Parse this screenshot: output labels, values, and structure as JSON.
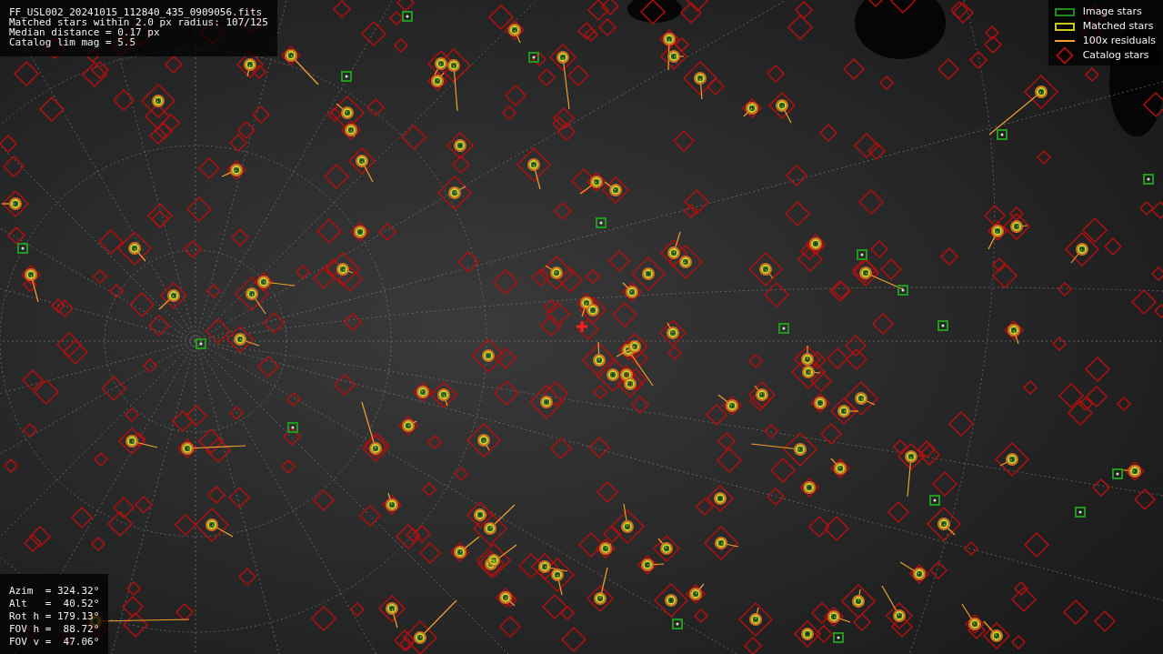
{
  "header": {
    "lines": [
      "FF_USL002_20241015_112840_435_0909056.fits",
      "Matched stars within 2.0 px radius: 107/125",
      "Median distance = 0.17 px",
      "Catalog lim mag = 5.5"
    ]
  },
  "legend": [
    {
      "kind": "image",
      "label": "Image stars"
    },
    {
      "kind": "matched",
      "label": "Matched stars"
    },
    {
      "kind": "residual",
      "label": "100x residuals"
    },
    {
      "kind": "catalog",
      "label": "Catalog stars"
    }
  ],
  "pointing": {
    "lines": [
      "Azim  = 324.32°",
      "Alt   =  40.52°",
      "Rot h = 179.13°",
      "FOV h =  88.72°",
      "FOV v =  47.06°"
    ]
  }
}
